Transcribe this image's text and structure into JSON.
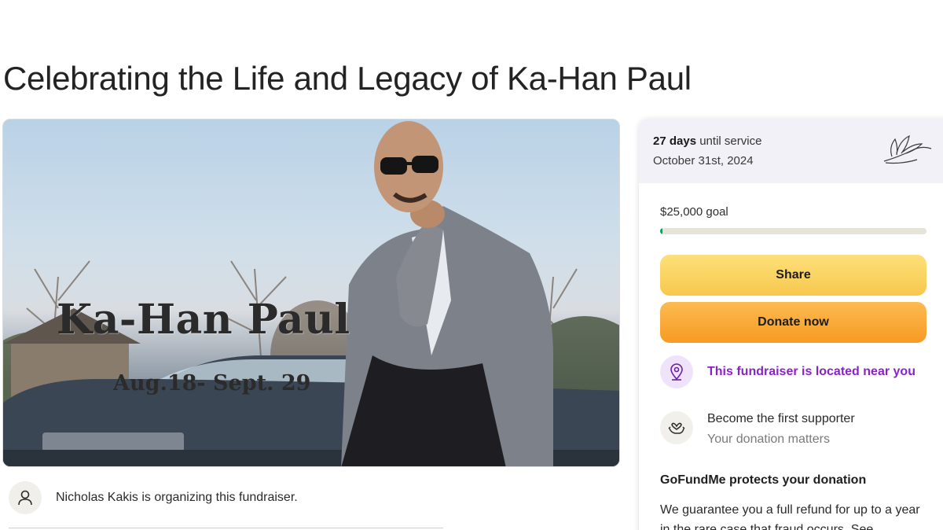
{
  "page": {
    "title": "Celebrating the Life and Legacy of Ka-Han Paul"
  },
  "hero": {
    "name_text": "Ka-Han Paul",
    "dates_text": "Aug.18- Sept. 29"
  },
  "organizer": {
    "text": "Nicholas Kakis is organizing this fundraiser.",
    "icon": "person-icon"
  },
  "panel": {
    "days_count": "27 days",
    "days_suffix": "until service",
    "service_date": "October 31st, 2024",
    "lily_icon": "lily-flower-icon",
    "goal_text": "$25,000 goal",
    "progress_fraction": 0.01,
    "share_label": "Share",
    "donate_label": "Donate now",
    "near_text": "This fundraiser is located near you",
    "near_icon": "location-pin-icon",
    "supporter_title": "Become the first supporter",
    "supporter_sub": "Your donation matters",
    "supporter_icon": "heart-hands-icon",
    "protect_title": "GoFundMe protects your donation",
    "protect_text": "We guarantee you a full refund for up to a year in the rare case that fraud occurs. See"
  },
  "colors": {
    "share_button": "#f7c84c",
    "donate_button": "#f79a24",
    "near_text": "#8a22c9",
    "progress_fill": "#0f9e5a"
  }
}
